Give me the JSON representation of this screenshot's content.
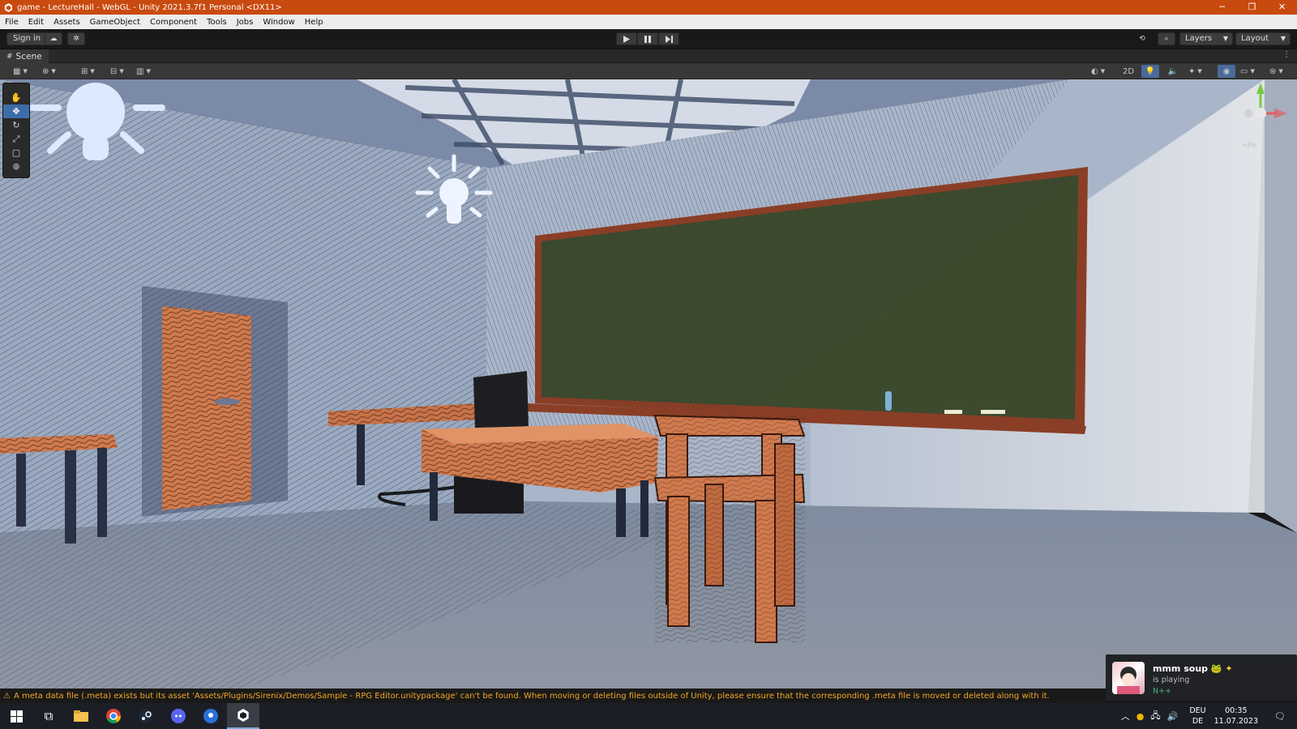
{
  "window": {
    "title": "game - LectureHall - WebGL - Unity 2021.3.7f1 Personal <DX11>",
    "controls": {
      "minimize": "─",
      "restore": "❐",
      "close": "✕"
    }
  },
  "menu": [
    "File",
    "Edit",
    "Assets",
    "GameObject",
    "Component",
    "Tools",
    "Jobs",
    "Window",
    "Help"
  ],
  "toolbar": {
    "sign_in": "Sign in",
    "layers": "Layers",
    "layout": "Layout"
  },
  "scene_tab": {
    "label": "Scene"
  },
  "scene_toolbar": {
    "mode_2d": "2D"
  },
  "status": {
    "message": "A meta data file (.meta) exists but its asset 'Assets/Plugins/Sirenix/Demos/Sample - RPG Editor.unitypackage' can't be found. When moving or deleting files outside of Unity, please ensure that the corresponding .meta file is moved or deleted along with it."
  },
  "discord": {
    "name": "mmm soup",
    "status": "is playing",
    "game": "N++"
  },
  "taskbar": {
    "language_1": "DEU",
    "language_2": "DE",
    "time": "00:35",
    "date": "11.07.2023"
  },
  "colors": {
    "titlebar": "#c94a0f",
    "chalkboard": "#3c4a2e",
    "wood": "#d07a4e",
    "wall": "#9aa9bf"
  }
}
